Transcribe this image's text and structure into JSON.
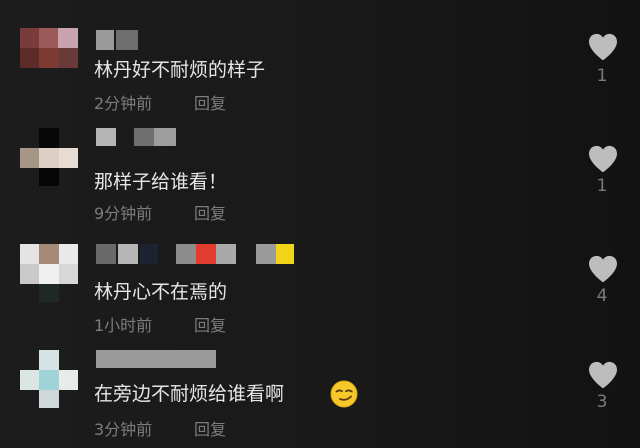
{
  "colors": {
    "background": "#171717",
    "comment_text": "#e6e6e6",
    "meta_text": "#7c7c7c",
    "like_icon": "#bdbdbd"
  },
  "comments": [
    {
      "text": "林丹好不耐烦的样子",
      "time": "2分钟前",
      "reply_label": "回复",
      "like_count": "1",
      "nickname": "(pixelated)",
      "like_icon": "heart-icon"
    },
    {
      "text": "那样子给谁看！",
      "time": "9分钟前",
      "reply_label": "回复",
      "like_count": "1",
      "nickname": "(pixelated)",
      "like_icon": "heart-icon"
    },
    {
      "text": "林丹心不在焉的",
      "time": "1小时前",
      "reply_label": "回复",
      "like_count": "4",
      "nickname": "(pixelated)",
      "like_icon": "heart-icon"
    },
    {
      "text": "在旁边不耐烦给谁看啊",
      "time": "3分钟前",
      "reply_label": "回复",
      "like_count": "3",
      "nickname": "(pixelated)",
      "like_icon": "heart-icon",
      "emoji": "smirk-emoji"
    }
  ]
}
